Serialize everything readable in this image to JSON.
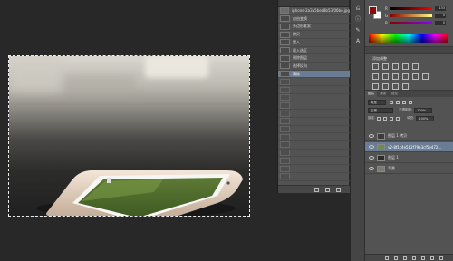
{
  "history": {
    "snapshot_label": "iphone-2a3a5bec8b53f06be.jpg",
    "items": [
      {
        "label": "自由变换",
        "state": "normal"
      },
      {
        "label": "多边形套索",
        "state": "normal"
      },
      {
        "label": "拷贝",
        "state": "normal"
      },
      {
        "label": "置入",
        "state": "normal"
      },
      {
        "label": "载入选区",
        "state": "normal"
      },
      {
        "label": "删除图层",
        "state": "normal"
      },
      {
        "label": "选择反向",
        "state": "normal"
      },
      {
        "label": "清除",
        "state": "active"
      },
      {
        "label": "",
        "state": "dim"
      },
      {
        "label": "",
        "state": "dim"
      },
      {
        "label": "",
        "state": "dim"
      },
      {
        "label": "",
        "state": "dim"
      },
      {
        "label": "",
        "state": "dim"
      },
      {
        "label": "",
        "state": "dim"
      },
      {
        "label": "",
        "state": "dim"
      },
      {
        "label": "",
        "state": "dim"
      },
      {
        "label": "",
        "state": "dim"
      },
      {
        "label": "",
        "state": "dim"
      },
      {
        "label": "",
        "state": "dim"
      },
      {
        "label": "",
        "state": "dim"
      },
      {
        "label": "",
        "state": "dim"
      }
    ]
  },
  "color": {
    "foreground": "#8c0c0c",
    "background": "#ffffff",
    "sliders": [
      {
        "label": "R",
        "value": "133",
        "gradient": "linear-gradient(90deg,#000,#f00)"
      },
      {
        "label": "G",
        "value": "0",
        "gradient": "linear-gradient(90deg,#800,#ff8)"
      },
      {
        "label": "B",
        "value": "0",
        "gradient": "linear-gradient(90deg,#800,#80f)"
      }
    ]
  },
  "adjustments": {
    "title": "添加调整"
  },
  "layers": {
    "tabs": [
      "图层",
      "通道",
      "路径"
    ],
    "kind_label": "类型",
    "blend_mode": "正常",
    "opacity_label": "不透明度:",
    "opacity_value": "100%",
    "lock_label": "锁定:",
    "fill_label": "填充:",
    "fill_value": "100%",
    "items": [
      {
        "name": "图层 1 拷贝",
        "active": false,
        "thumb": "#3b3b3b"
      },
      {
        "name": "v2-8f1c4e5b2f79a3cf5e472...",
        "active": true,
        "thumb": "#6f8b4f"
      },
      {
        "name": "图层 1",
        "active": false,
        "thumb": "#2b2b2b"
      },
      {
        "name": "背景",
        "active": false,
        "thumb": "#7d7a74"
      }
    ]
  }
}
